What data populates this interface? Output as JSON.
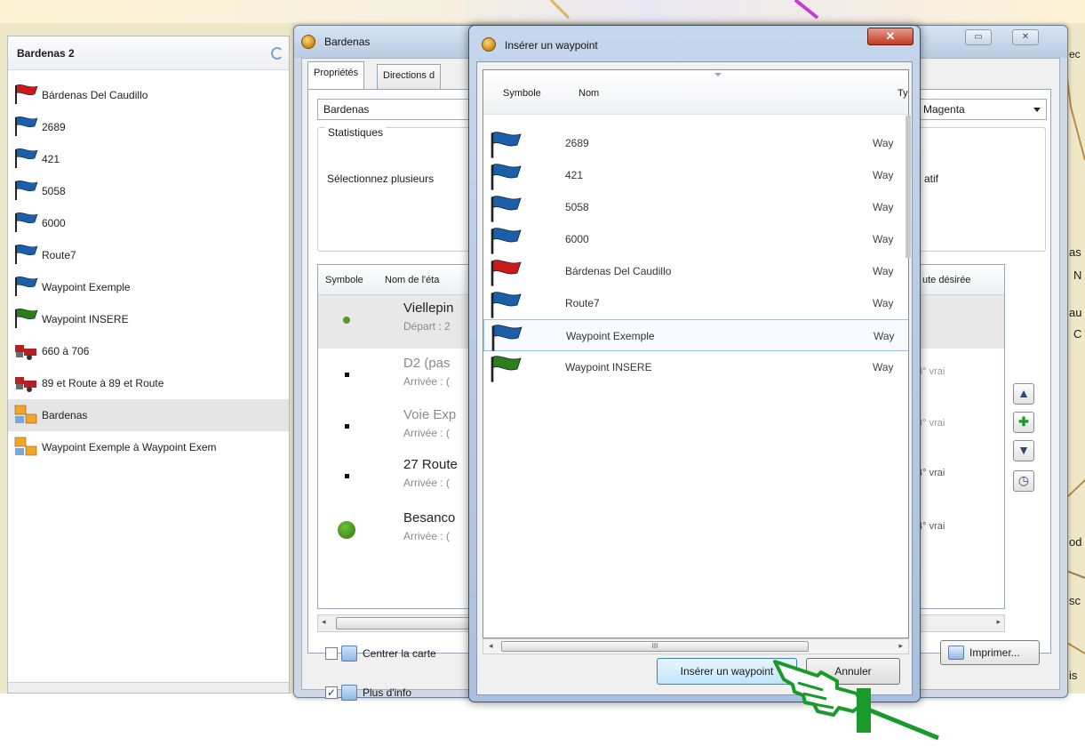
{
  "colors": {
    "flag_blue": "#1a5fa8",
    "flag_red": "#cc1a1a",
    "flag_green": "#2e7d1d",
    "hand_green": "#1a9a2a"
  },
  "left_panel": {
    "title": "Bardenas 2",
    "items": [
      {
        "icon": "red-flag-icon",
        "label": "Bárdenas Del Caudillo"
      },
      {
        "icon": "blue-flag-icon",
        "label": "2689"
      },
      {
        "icon": "blue-flag-icon",
        "label": "421"
      },
      {
        "icon": "blue-flag-icon",
        "label": "5058"
      },
      {
        "icon": "blue-flag-icon",
        "label": "6000"
      },
      {
        "icon": "blue-flag-icon",
        "label": "Route7"
      },
      {
        "icon": "blue-flag-icon",
        "label": "Waypoint Exemple"
      },
      {
        "icon": "green-flag-icon",
        "label": "Waypoint INSERE"
      },
      {
        "icon": "track-icon",
        "label": "660 à 706"
      },
      {
        "icon": "track-icon",
        "label": "89 et Route à 89 et Route"
      },
      {
        "icon": "route-icon",
        "label": "Bardenas"
      },
      {
        "icon": "route-icon",
        "label": "Waypoint Exemple à Waypoint Exem"
      }
    ]
  },
  "route_window": {
    "title": "Bardenas",
    "tabs": [
      "Propriétés",
      "Directions d"
    ],
    "name_value": "Bardenas",
    "color_value": "Magenta",
    "stats_legend": "Statistiques",
    "stats_text": "Sélectionnez plusieurs",
    "stats_right": "atif",
    "columns": {
      "symbol": "Symbole",
      "name": "Nom de l'éta",
      "heading": "ute désirée"
    },
    "rows": [
      {
        "title": "Viellepin",
        "sub": "Départ : 2",
        "bearing": ""
      },
      {
        "title": "D2 (pas",
        "sub": "Arrivée : (",
        "bearing": "3° vrai"
      },
      {
        "title": "Voie Exp",
        "sub": "Arrivée : (",
        "bearing": "3° vrai"
      },
      {
        "title": "27 Route",
        "sub": "Arrivée : (",
        "bearing": "4° vrai"
      },
      {
        "title": "Besanco",
        "sub": "Arrivée : (",
        "bearing": "4° vrai"
      }
    ],
    "center_map_label": "Centrer la carte",
    "more_info_label": "Plus d'info",
    "print_label": "Imprimer..."
  },
  "dialog": {
    "title": "Insérer un waypoint",
    "columns": {
      "symbol": "Symbole",
      "name": "Nom",
      "type": "Ty"
    },
    "rows": [
      {
        "flag": "blue-flag-icon",
        "name": "2689",
        "type": "Way"
      },
      {
        "flag": "blue-flag-icon",
        "name": "421",
        "type": "Way"
      },
      {
        "flag": "blue-flag-icon",
        "name": "5058",
        "type": "Way"
      },
      {
        "flag": "blue-flag-icon",
        "name": "6000",
        "type": "Way"
      },
      {
        "flag": "red-flag-icon",
        "name": "Bárdenas Del Caudillo",
        "type": "Way"
      },
      {
        "flag": "blue-flag-icon",
        "name": "Route7",
        "type": "Way"
      },
      {
        "flag": "blue-flag-icon",
        "name": "Waypoint Exemple",
        "type": "Way"
      },
      {
        "flag": "green-flag-icon",
        "name": "Waypoint INSERE",
        "type": "Way"
      }
    ],
    "selected_row": "Waypoint Exemple",
    "scroll_thumb": "III",
    "insert_label": "Insérer un waypoint",
    "cancel_label": "Annuler"
  },
  "map_fragments": [
    "ec",
    "as",
    "N",
    "au",
    "C",
    "od",
    "sc",
    "is"
  ]
}
